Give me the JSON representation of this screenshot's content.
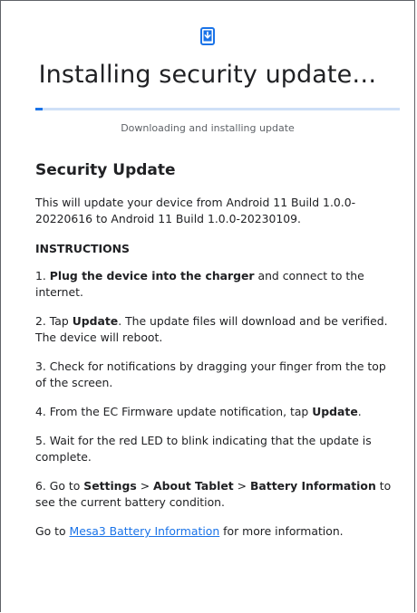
{
  "header": {
    "icon": "phone-download-icon",
    "title": "Installing security update…"
  },
  "progress": {
    "value_fraction": 0.02,
    "status": "Downloading and installing update"
  },
  "section": {
    "title": "Security Update",
    "intro": "This will update your device from Android 11 Build 1.0.0-20220616 to Android 11 Build 1.0.0-20230109."
  },
  "instructions": {
    "heading": "INSTRUCTIONS",
    "step1": {
      "num": "1. ",
      "bold": "Plug the device into the charger",
      "rest": " and connect to the internet."
    },
    "step2": {
      "pre": "2. Tap ",
      "bold": "Update",
      "rest": ". The update files will download and be verified. The device will reboot."
    },
    "step3": {
      "text": "3. Check for notifications by dragging your finger from the top of the screen."
    },
    "step4": {
      "pre": "4. From the EC Firmware update notification, tap ",
      "bold": "Update",
      "rest": "."
    },
    "step5": {
      "text": "5. Wait for the red LED to blink indicating that the update is complete."
    },
    "step6": {
      "pre": "6. Go to ",
      "settings": "Settings",
      "sep1": " > ",
      "about": "About Tablet",
      "sep2": " > ",
      "battery": "Battery Information",
      "rest": " to see the current battery condition."
    }
  },
  "footer": {
    "pre": "Go to ",
    "link": "Mesa3 Battery Information",
    "rest": " for more information."
  },
  "colors": {
    "accent": "#1a73e8",
    "track": "#cfe0f7"
  }
}
